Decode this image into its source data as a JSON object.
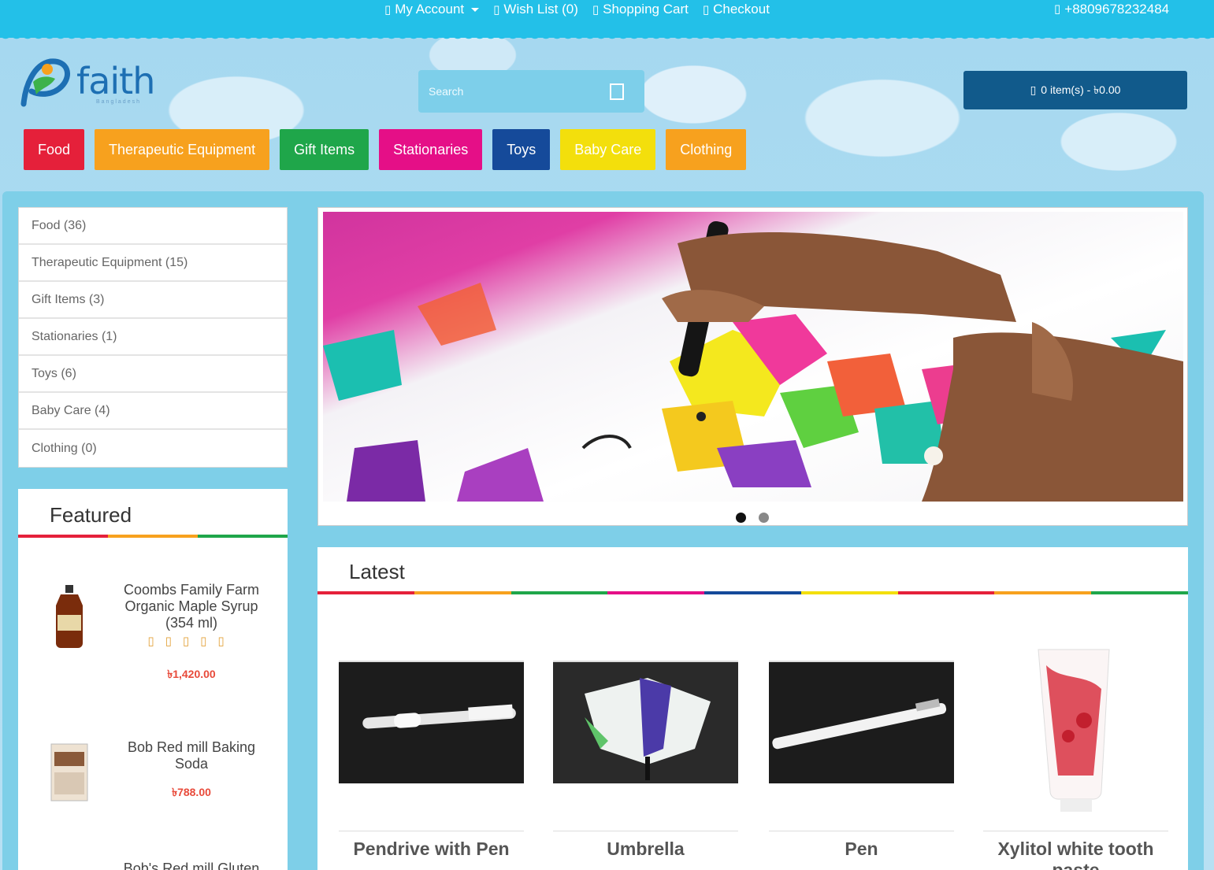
{
  "topnav": {
    "account": "My Account",
    "wishlist": "Wish List (0)",
    "cart": "Shopping Cart",
    "checkout": "Checkout",
    "phone": "+8809678232484",
    "icon_glyph": "▯"
  },
  "logo": {
    "text": "faith",
    "sub": "Bangladesh"
  },
  "search": {
    "placeholder": "Search"
  },
  "cart_button": {
    "icon": "▯",
    "label": "0 item(s) - ৳0.00"
  },
  "categories": [
    {
      "label": "Food",
      "color": "#e5203a"
    },
    {
      "label": "Therapeutic Equipment",
      "color": "#f7a11e"
    },
    {
      "label": "Gift Items",
      "color": "#1fa64a"
    },
    {
      "label": "Stationaries",
      "color": "#e50f87"
    },
    {
      "label": "Toys",
      "color": "#154a9a"
    },
    {
      "label": "Baby Care",
      "color": "#f3df0c"
    },
    {
      "label": "Clothing",
      "color": "#f7a11e"
    }
  ],
  "sidebar": {
    "items": [
      {
        "label": "Food (36)"
      },
      {
        "label": "Therapeutic Equipment (15)"
      },
      {
        "label": "Gift Items (3)"
      },
      {
        "label": "Stationaries (1)"
      },
      {
        "label": "Toys (6)"
      },
      {
        "label": "Baby Care (4)"
      },
      {
        "label": "Clothing (0)"
      }
    ]
  },
  "featured": {
    "title": "Featured",
    "items": [
      {
        "name": "Coombs Family Farm Organic Maple Syrup (354 ml)",
        "stars": "▯▯▯▯▯",
        "price": "৳1,420.00"
      },
      {
        "name": "Bob Red mill Baking Soda",
        "price": "৳788.00"
      },
      {
        "name": "Bob's Red mill Gluten"
      }
    ]
  },
  "slider": {
    "dots": 2,
    "active": 0
  },
  "latest": {
    "title": "Latest",
    "products": [
      {
        "name": "Pendrive with Pen"
      },
      {
        "name": "Umbrella"
      },
      {
        "name": "Pen"
      },
      {
        "name": "Xylitol white tooth paste"
      }
    ]
  },
  "rainbow_colors": [
    "#e5203a",
    "#f7a11e",
    "#1fa64a",
    "#e50f87",
    "#154a9a",
    "#f3df0c",
    "#e5203a",
    "#f7a11e",
    "#1fa64a"
  ]
}
